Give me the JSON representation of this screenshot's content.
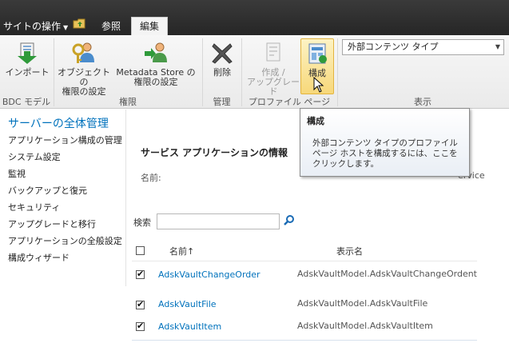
{
  "topbar": {
    "site_actions": "サイトの操作",
    "tab_browse": "参照",
    "tab_edit": "編集"
  },
  "ribbon": {
    "import_label": "インポート",
    "object_permissions_line1": "オブジェクトの",
    "object_permissions_line2": "権限の設定",
    "metadata_permissions_line1": "Metadata Store の",
    "metadata_permissions_line2": "権限の設定",
    "delete_label": "削除",
    "create_upgrade_line1": "作成 /",
    "create_upgrade_line2": "アップグレード",
    "configure_label": "構成",
    "groups": {
      "bdc_models": "BDC モデル",
      "permissions": "権限",
      "manage": "管理",
      "profile_pages": "プロファイル ページ",
      "view": "表示"
    },
    "view_select_value": "外部コンテンツ タイプ"
  },
  "leftnav": {
    "title": "サーバーの全体管理",
    "items": [
      "アプリケーション構成の管理",
      "システム設定",
      "監視",
      "バックアップと復元",
      "セキュリティ",
      "アップグレードと移行",
      "アプリケーションの全般設定",
      "構成ウィザード"
    ]
  },
  "main": {
    "section_title": "サービス アプリケーションの情報",
    "name_label": "名前:",
    "service_text": "ervice",
    "search_label": "検索",
    "columns": {
      "name": "名前↑",
      "display_name": "表示名"
    },
    "rows": [
      {
        "name": "AdskVaultChangeOrder",
        "display": "AdskVaultModel.AdskVaultChangeOrdent",
        "checked": true
      },
      {
        "name": "AdskVaultFile",
        "display": "AdskVaultModel.AdskVaultFile",
        "checked": true
      },
      {
        "name": "AdskVaultItem",
        "display": "AdskVaultModel.AdskVaultItem",
        "checked": true
      }
    ]
  },
  "tooltip": {
    "title": "構成",
    "body": "外部コンテンツ タイプのプロファイル ページ ホストを構成するには、ここをクリックします。"
  },
  "colors": {
    "accent": "#0072bc",
    "topbar": "#2b2b2b",
    "highlight": "#f7d87a"
  }
}
